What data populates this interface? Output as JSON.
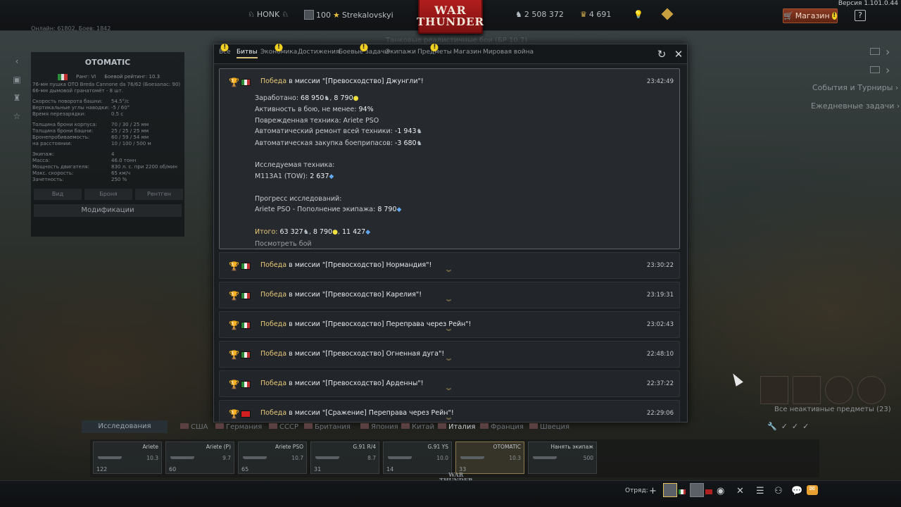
{
  "topbar": {
    "version": "Версия 1.101.0.44",
    "clan": "HONK",
    "level": "100",
    "username": "Strekalovskyi",
    "logo_line1": "WAR",
    "logo_line2": "THUNDER",
    "silver_lions": "2 508 372",
    "eagles": "4 691",
    "shop_label": "Магазин",
    "help_label": "?"
  },
  "background": {
    "online_text": "Онлайн: 61802, Боев: 1842",
    "mode_text": "Танковые реалистичные бои (БР 10.7)"
  },
  "vehicle_panel": {
    "name": "OTOMATIC",
    "rank": "Ранг: VI",
    "battle_rating": "Боевой рейтинг: 10.3",
    "weapon1": "76-мм пушка OTO Breda Cannone da 76/62 (Боезапас: 90)",
    "weapon2": "66-мм дымовой гранатомёт - 8 шт.",
    "stats": [
      {
        "label": "Скорость поворота башни:",
        "value": "54.5°/с"
      },
      {
        "label": "Вертикальные углы наводки:",
        "value": "-5 / 60°"
      },
      {
        "label": "Время перезарядки:",
        "value": "0.5 с"
      },
      {
        "label": "Толщина брони корпуса:",
        "value": "70 / 30 / 25 мм"
      },
      {
        "label": "Толщина брони башни:",
        "value": "25 / 25 / 25 мм"
      },
      {
        "label": "Бронепробиваемость:",
        "value": "60 / 59 / 54 мм"
      },
      {
        "label": "на расстоянии:",
        "value": "10 / 100 / 500 м"
      },
      {
        "label": "Экипаж:",
        "value": "4"
      },
      {
        "label": "Масса:",
        "value": "46.0 тонн"
      },
      {
        "label": "Мощность двигателя:",
        "value": "830 л. с. при 2200 об/мин"
      },
      {
        "label": "Макс. скорость:",
        "value": "65 км/ч"
      },
      {
        "label": "Зачетность:",
        "value": "250 %"
      }
    ],
    "tabs": [
      "Вид",
      "Броня",
      "Рентген"
    ],
    "modifications": "Модификации"
  },
  "right_links": {
    "events": "События и Турниры",
    "daily": "Ежедневные задачи",
    "inactive_items": "Все неактивные предметы (23)"
  },
  "dialog": {
    "tabs": [
      {
        "label": "Все",
        "warn": true
      },
      {
        "label": "Битвы",
        "warn": false,
        "active": true
      },
      {
        "label": "Экономика",
        "warn": true
      },
      {
        "label": "Достижения",
        "warn": false
      },
      {
        "label": "Боевые задачи",
        "warn": true
      },
      {
        "label": "Экипажи",
        "warn": false
      },
      {
        "label": "Предметы",
        "warn": true
      },
      {
        "label": "Магазин",
        "warn": false
      },
      {
        "label": "Мировая война",
        "warn": false
      }
    ],
    "refresh_icon": "refresh-icon",
    "close_icon": "close-icon",
    "expanded": {
      "result": "Победа",
      "mission": " в миссии \"[Превосходство] Джунгли\"!",
      "time": "23:42:49",
      "earned_label": "Заработано: ",
      "earned_silver": "68 950",
      "earned_gold": "8 790",
      "activity": "Активность в бою, не менее: ",
      "activity_value": "94%",
      "damaged": "Поврежденная техника: ",
      "damaged_value": "Ariete PSO",
      "repair": "Автоматический ремонт всей техники: ",
      "repair_value": "-1 943",
      "ammo": "Автоматическая закупка боеприпасов: ",
      "ammo_value": "-3 680",
      "researched_title": "Исследуемая техника:",
      "researched_vehicle": "M113A1 (TOW): ",
      "researched_value": "2 637",
      "progress_title": "Прогресс исследований:",
      "progress_item": "Ariete PSO - Пополнение экипажа: ",
      "progress_value": "8 790",
      "total_label": "Итого: ",
      "total_silver": "63 327",
      "total_gold": "8 790",
      "total_rp": "11 427",
      "replay_link": "Посмотреть бой"
    },
    "entries": [
      {
        "result": "Победа",
        "mission": " в миссии \"[Превосходство] Нормандия\"!",
        "time": "23:30:22"
      },
      {
        "result": "Победа",
        "mission": " в миссии \"[Превосходство] Карелия\"!",
        "time": "23:19:31"
      },
      {
        "result": "Победа",
        "mission": " в миссии \"[Превосходство] Переправа через Рейн\"!",
        "time": "23:02:43"
      },
      {
        "result": "Победа",
        "mission": " в миссии \"[Превосходство] Огненная дуга\"!",
        "time": "22:48:10"
      },
      {
        "result": "Победа",
        "mission": " в миссии \"[Превосходство] Арденны\"!",
        "time": "22:37:22"
      },
      {
        "result": "Победа",
        "mission": " в миссии \"[Сражение] Переправа через Рейн\"!",
        "time": "22:29:06"
      }
    ]
  },
  "research": {
    "label": "Исследования",
    "nations": [
      "США",
      "Германия",
      "СССР",
      "Британия",
      "Япония",
      "Китай",
      "Италия",
      "Франция",
      "Швеция"
    ],
    "active_nation": "Италия"
  },
  "slots": [
    {
      "name": "Ariete",
      "br": "10.3",
      "count": "122"
    },
    {
      "name": "Ariete (P)",
      "br": "9.7",
      "count": "60"
    },
    {
      "name": "Ariete PSO",
      "br": "10.7",
      "count": "65"
    },
    {
      "name": "G.91 R/4",
      "br": "8.7",
      "count": "31"
    },
    {
      "name": "G.91 YS",
      "br": "10.0",
      "count": "14"
    },
    {
      "name": "OTOMATIC",
      "br": "10.3",
      "count": "33"
    },
    {
      "name": "Нанять экипаж",
      "br": "500",
      "count": ""
    }
  ],
  "bottombar": {
    "squad_label": "Отряд:"
  },
  "colors": {
    "accent_gold": "#e7c878",
    "logo_red": "#b11d1d",
    "rp_blue": "#62a8f0"
  }
}
